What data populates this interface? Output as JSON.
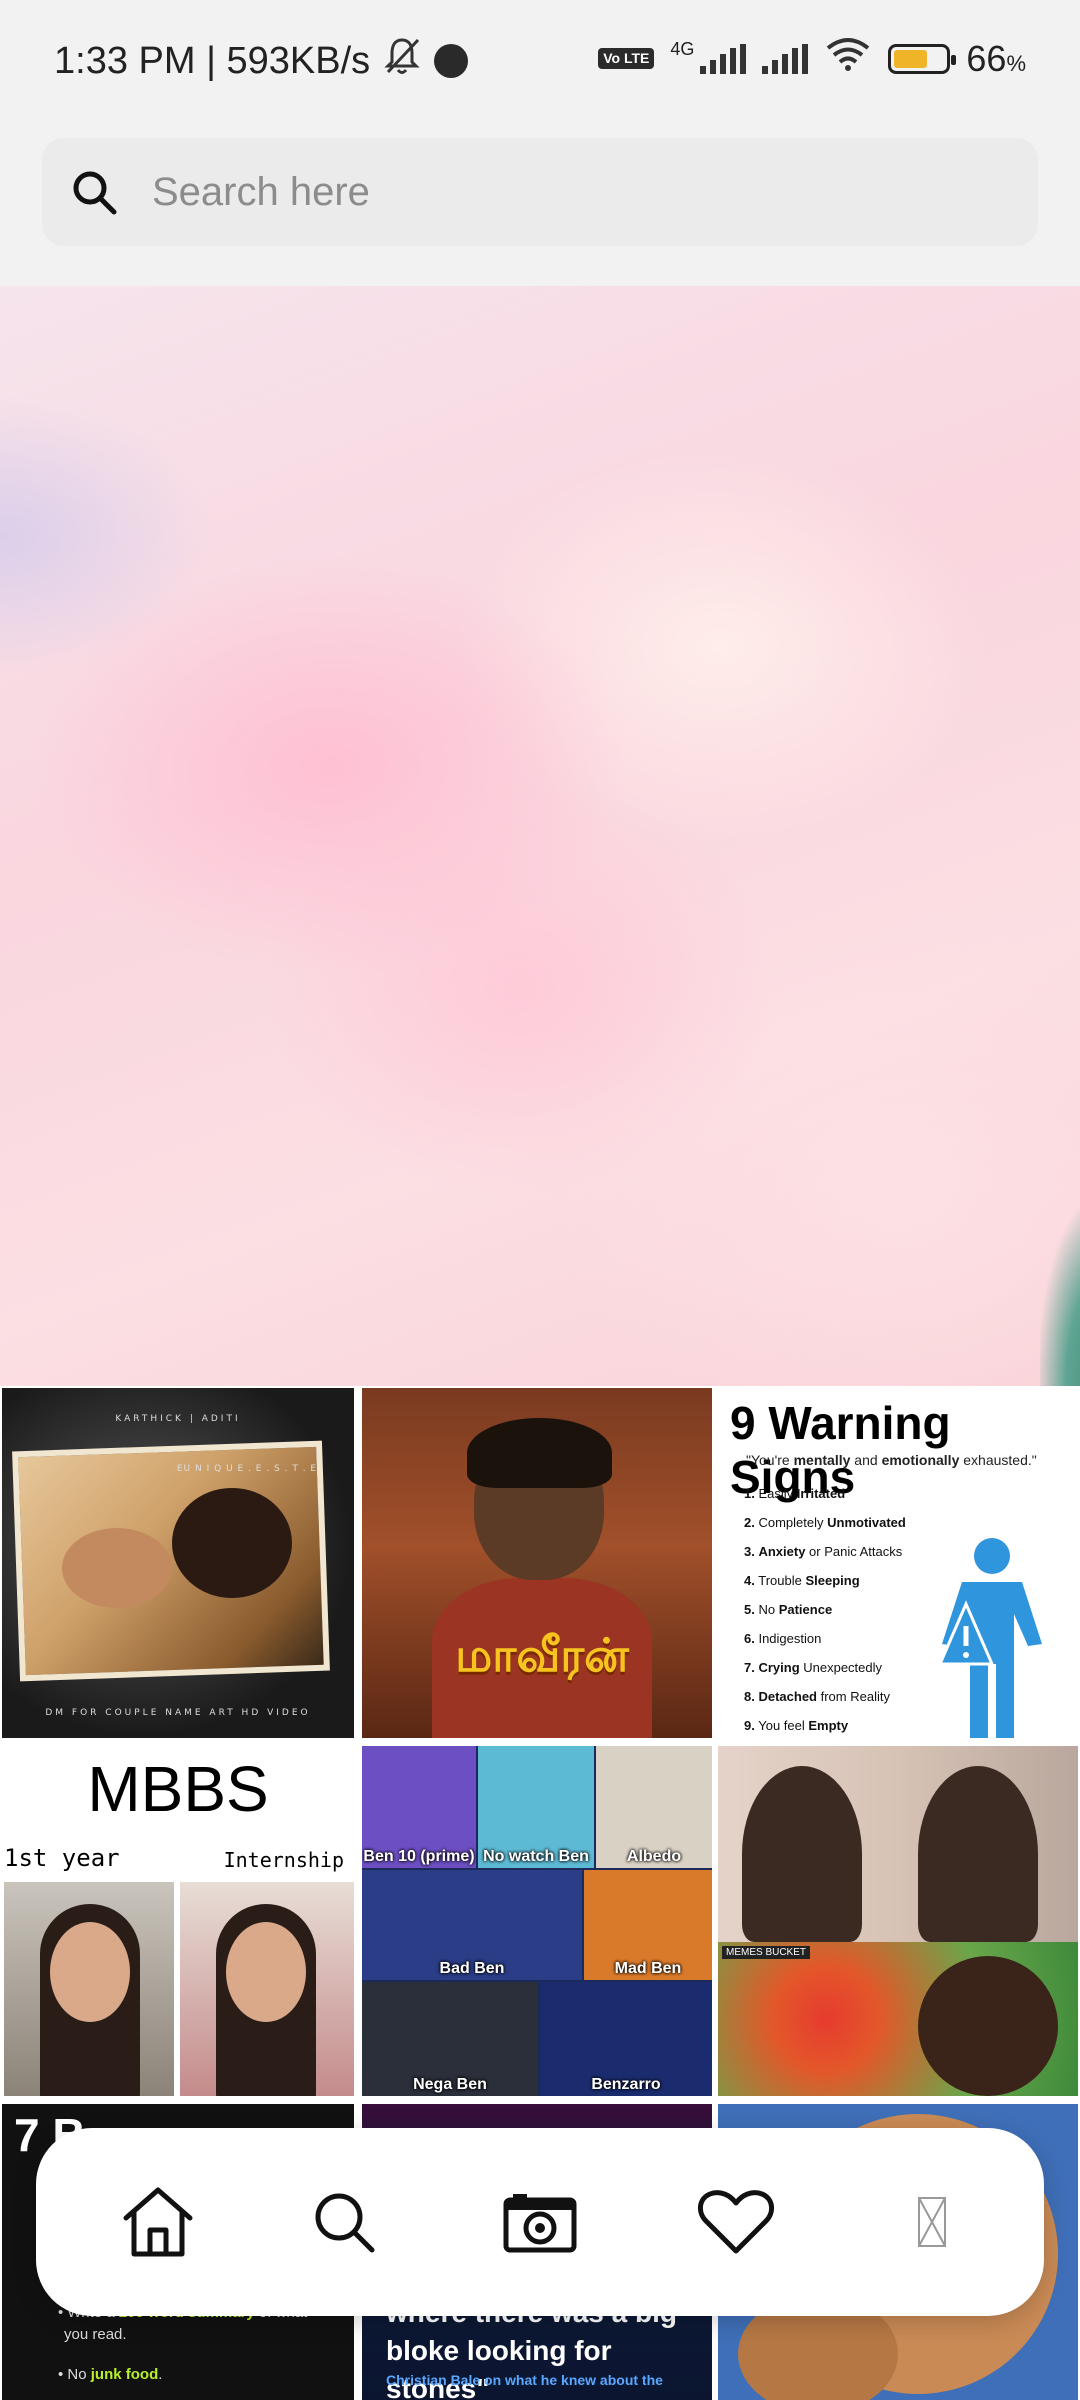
{
  "status_bar": {
    "time_speed": "1:33 PM | 593KB/s",
    "volte": "Vo LTE",
    "network": "4G",
    "battery": "66",
    "battery_unit": "%",
    "battery_level": 0.66
  },
  "search": {
    "placeholder": "Search here"
  },
  "tiles": {
    "couple_poster": {
      "caption_top": "KARTHICK | ADITI",
      "caption_right": "EU N I Q U E . E . S . T . E",
      "caption_bottom": "DM FOR COUPLE NAME ART HD VIDEO"
    },
    "movie_poster": {
      "title": "மாவீரன்"
    },
    "warning_signs": {
      "title": "9 Warning Signs",
      "quote_prefix": "\"You're ",
      "quote_bold1": "mentally",
      "quote_mid": " and ",
      "quote_bold2": "emotionally",
      "quote_suffix": " exhausted.\"",
      "items": [
        {
          "num": "1.",
          "pre": "Easily ",
          "bold": "Irritated",
          "post": ""
        },
        {
          "num": "2.",
          "pre": "Completely ",
          "bold": "Unmotivated",
          "post": ""
        },
        {
          "num": "3.",
          "pre": "",
          "bold": "Anxiety",
          "post": " or Panic Attacks"
        },
        {
          "num": "4.",
          "pre": "Trouble ",
          "bold": "Sleeping",
          "post": ""
        },
        {
          "num": "5.",
          "pre": "No ",
          "bold": "Patience",
          "post": ""
        },
        {
          "num": "6.",
          "pre": "Indigestion",
          "bold": "",
          "post": ""
        },
        {
          "num": "7.",
          "pre": "",
          "bold": "Crying",
          "post": " Unexpectedly"
        },
        {
          "num": "8.",
          "pre": "",
          "bold": "Detached",
          "post": " from Reality"
        },
        {
          "num": "9.",
          "pre": "You feel ",
          "bold": "Empty",
          "post": ""
        }
      ]
    },
    "mbbs": {
      "title": "MBBS",
      "left_label": "1st year",
      "right_label": "Internship"
    },
    "ben10": {
      "labels": [
        "Ben 10 (prime)",
        "No watch Ben",
        "Albedo",
        "Bad Ben",
        "Mad Ben",
        "Nega Ben",
        "Benzarro"
      ]
    },
    "meme": {
      "tag": "MEMES BUCKET"
    },
    "tips": {
      "big": "7 B",
      "line1_pre": "Write a ",
      "line1_bold": "200 word summary",
      "line1_post": " of what",
      "line1_cont": "you read.",
      "line2_pre": "No ",
      "line2_bold": "junk food",
      "line2_post": "."
    },
    "quote": {
      "text": "where there was a big bloke looking for stones\"",
      "sub": "Christian Bale on what he knew about the"
    }
  },
  "bottom_nav": {
    "items": [
      "home-icon",
      "search-icon",
      "camera-icon",
      "heart-icon",
      "placeholder-icon"
    ]
  }
}
